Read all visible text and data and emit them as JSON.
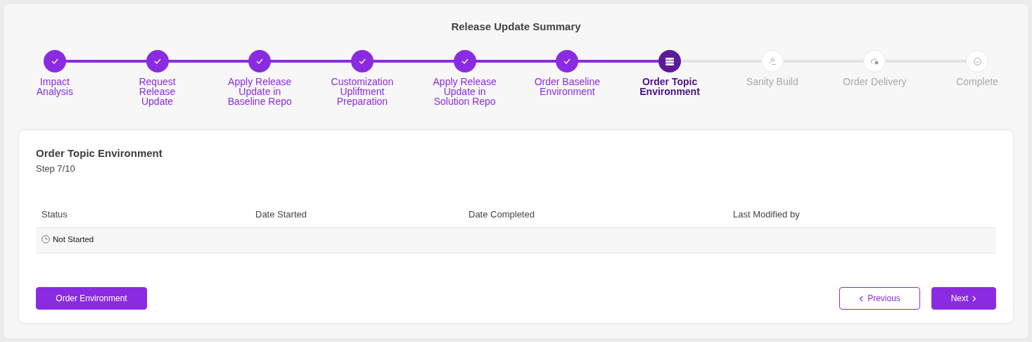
{
  "title": "Release Update Summary",
  "steps": [
    {
      "label": "Impact Analysis",
      "completed": true,
      "selected": false
    },
    {
      "label": "Request Release Update",
      "completed": true,
      "selected": false
    },
    {
      "label": "Apply Release Update in Baseline Repo",
      "completed": true,
      "selected": false
    },
    {
      "label": "Customization Upliftment Preparation",
      "completed": true,
      "selected": false
    },
    {
      "label": "Apply Release Update in Solution Repo",
      "completed": true,
      "selected": false
    },
    {
      "label": "Order Baseline Environment",
      "completed": true,
      "selected": false
    },
    {
      "label": "Order Topic Environment",
      "completed": false,
      "selected": true
    },
    {
      "label": "Sanity Build",
      "completed": false,
      "selected": false
    },
    {
      "label": "Order Delivery",
      "completed": false,
      "selected": false
    },
    {
      "label": "Complete",
      "completed": false,
      "selected": false
    }
  ],
  "card": {
    "title": "Order Topic Environment",
    "subtitle": "Step 7/10",
    "table": {
      "columns": [
        "Status",
        "Date Started",
        "Date Completed",
        "Last Modified by"
      ],
      "rows": [
        {
          "status": "Not Started"
        }
      ]
    },
    "buttons": [
      {
        "label": "Order Environment",
        "kind": "primary"
      },
      {
        "label": "Previous",
        "kind": "previous"
      },
      {
        "label": "Next",
        "kind": "next"
      }
    ]
  }
}
